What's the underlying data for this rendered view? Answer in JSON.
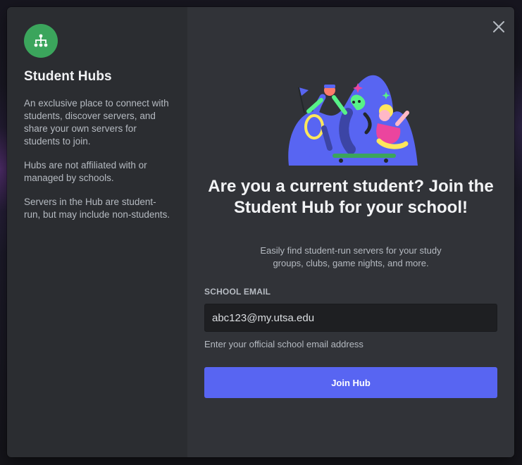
{
  "sidebar": {
    "title": "Student Hubs",
    "paragraphs": [
      "An exclusive place to connect with students, discover servers, and share your own servers for students to join.",
      "Hubs are not affiliated with or managed by schools.",
      "Servers in the Hub are student-run, but may include non-students."
    ],
    "icon": "hub-network-icon"
  },
  "main": {
    "headline": "Are you a current student? Join the Student Hub for your school!",
    "subtext": "Easily find student-run servers for your study groups, clubs, game nights, and more.",
    "email_label": "SCHOOL EMAIL",
    "email_value": "abc123@my.utsa.edu",
    "email_hint": "Enter your official school email address",
    "join_button": "Join Hub",
    "close_icon": "close-icon"
  },
  "colors": {
    "accent": "#5865f2",
    "hub_green": "#3ba55c",
    "sidebar_bg": "#2b2d31",
    "main_bg": "#313338",
    "input_bg": "#1e1f22"
  }
}
